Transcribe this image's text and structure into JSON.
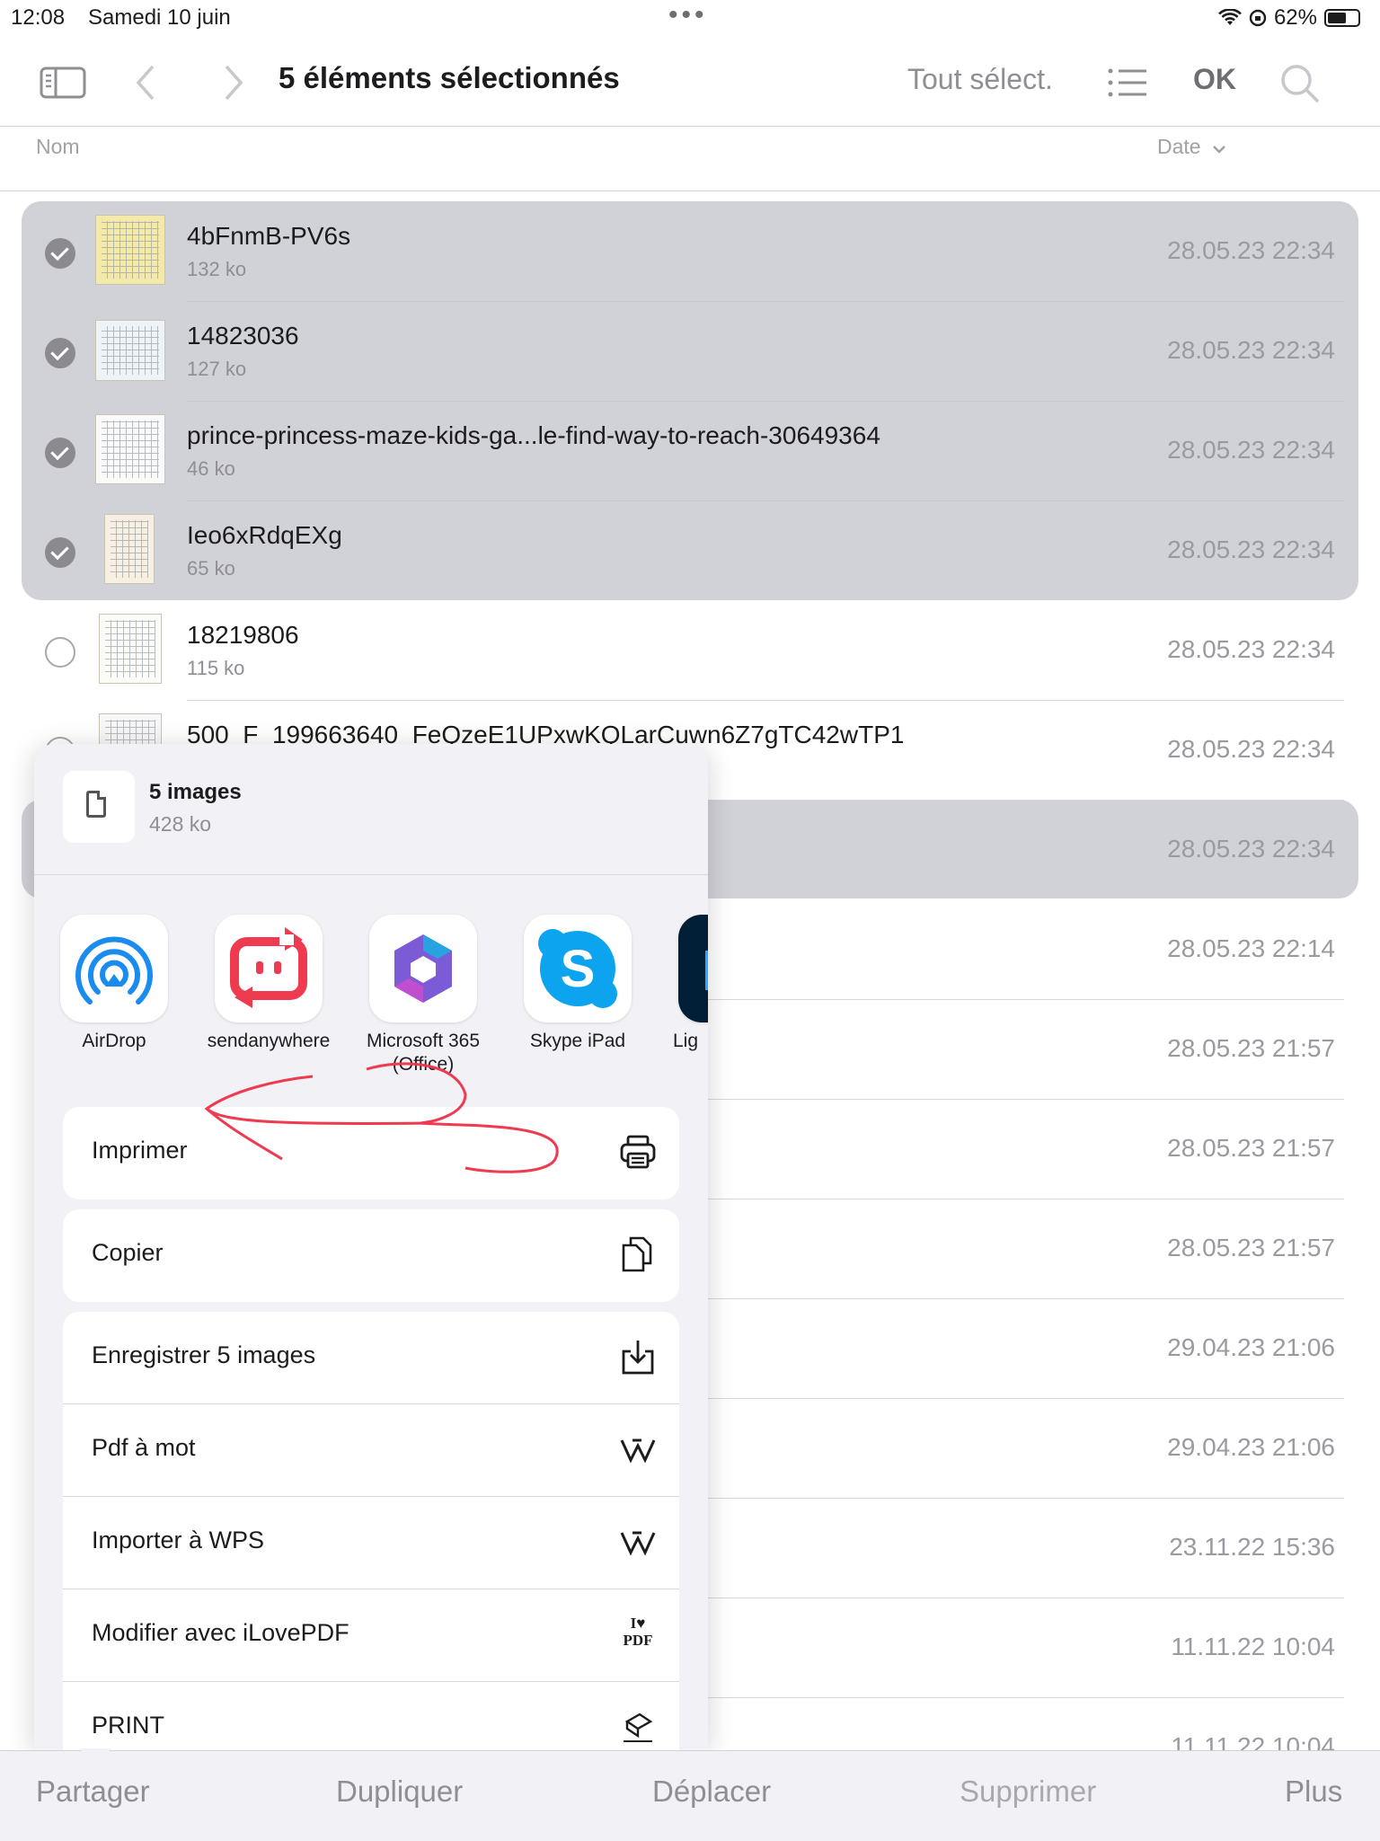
{
  "status": {
    "time": "12:08",
    "date": "Samedi 10 juin",
    "battery_pct": "62%",
    "battery_level": 0.62
  },
  "nav": {
    "title": "5 éléments sélectionnés",
    "select_all": "Tout sélect.",
    "done": "OK"
  },
  "columns": {
    "name": "Nom",
    "date": "Date"
  },
  "files": [
    {
      "name": "4bFnmB-PV6s",
      "size": "132 ko",
      "date": "28.05.23 22:34",
      "selected": true
    },
    {
      "name": "14823036",
      "size": "127 ko",
      "date": "28.05.23 22:34",
      "selected": true
    },
    {
      "name": "prince-princess-maze-kids-ga...le-find-way-to-reach-30649364",
      "size": "46 ko",
      "date": "28.05.23 22:34",
      "selected": true
    },
    {
      "name": "Ieo6xRdqEXg",
      "size": "65 ko",
      "date": "28.05.23 22:34",
      "selected": true
    },
    {
      "name": "18219806",
      "size": "115 ko",
      "date": "28.05.23 22:34",
      "selected": false
    },
    {
      "name": "500_F_199663640_FeQzeE1UPxwKQLarCuwn6Z7gTC42wTP1",
      "size": "",
      "date": "28.05.23 22:34",
      "selected": false
    }
  ],
  "more_dates": [
    "28.05.23 22:34",
    "28.05.23 22:14",
    "28.05.23 21:57",
    "28.05.23 21:57",
    "28.05.23 21:57",
    "29.04.23 21:06",
    "29.04.23 21:06",
    "23.11.22 15:36",
    "11.11.22 10:04",
    "11.11.22 10:04"
  ],
  "share": {
    "title": "5 images",
    "size": "428 ko",
    "apps": [
      {
        "label": "AirDrop",
        "icon": "airdrop-icon"
      },
      {
        "label": "sendanywhere",
        "icon": "sendanywhere-icon"
      },
      {
        "label": "Microsoft 365 (Office)",
        "icon": "microsoft365-icon"
      },
      {
        "label": "Skype iPad",
        "icon": "skype-icon"
      },
      {
        "label": "Lig",
        "icon": "lightroom-icon"
      }
    ],
    "actions_group1": [
      {
        "label": "Imprimer",
        "icon": "printer-icon"
      }
    ],
    "actions_group2": [
      {
        "label": "Copier",
        "icon": "copy-icon"
      }
    ],
    "actions_group3": [
      {
        "label": "Enregistrer 5 images",
        "icon": "save-icon"
      },
      {
        "label": "Pdf à mot",
        "icon": "wps-icon"
      },
      {
        "label": "Importer à WPS",
        "icon": "wps-icon"
      },
      {
        "label": "Modifier avec iLovePDF",
        "icon": "ilovepdf-icon"
      },
      {
        "label": "PRINT",
        "icon": "canon-print-icon"
      }
    ],
    "ilovepdf_mark": "I♥ PDF"
  },
  "toolbar": {
    "share": "Partager",
    "duplicate": "Dupliquer",
    "move": "Déplacer",
    "delete": "Supprimer",
    "more": "Plus"
  },
  "colors": {
    "accent_red": "#ee3b4f",
    "selection": "#d1d1d8",
    "skype": "#0da4ef",
    "airdrop": "#1a8cf0"
  }
}
